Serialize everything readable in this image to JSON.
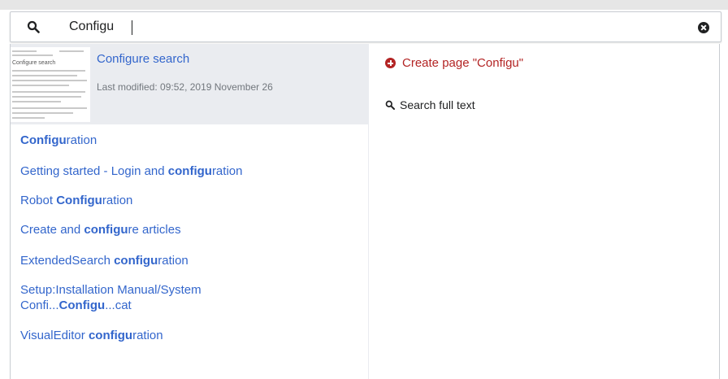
{
  "search": {
    "value": "Configu",
    "placeholder": ""
  },
  "icons": {
    "search": "search-icon",
    "clear": "clear-icon",
    "create": "plus-circle-icon",
    "fulltext": "search-icon"
  },
  "colors": {
    "link": "#3366cc",
    "create": "#b32424",
    "highlight_bg": "#eaecf0"
  },
  "top_result": {
    "title": "Configure search",
    "meta": "Last modified: 09:52, 2019 November 26",
    "thumbnail_text": "Configure search"
  },
  "results": [
    {
      "parts": [
        {
          "text": "Configu",
          "bold": true
        },
        {
          "text": "ration",
          "bold": false
        }
      ]
    },
    {
      "parts": [
        {
          "text": "Getting started - Login and ",
          "bold": false
        },
        {
          "text": "configu",
          "bold": true
        },
        {
          "text": "ration",
          "bold": false
        }
      ]
    },
    {
      "parts": [
        {
          "text": "Robot ",
          "bold": false
        },
        {
          "text": "Configu",
          "bold": true
        },
        {
          "text": "ration",
          "bold": false
        }
      ]
    },
    {
      "parts": [
        {
          "text": "Create and ",
          "bold": false
        },
        {
          "text": "configu",
          "bold": true
        },
        {
          "text": "re articles",
          "bold": false
        }
      ]
    },
    {
      "parts": [
        {
          "text": "ExtendedSearch ",
          "bold": false
        },
        {
          "text": "configu",
          "bold": true
        },
        {
          "text": "ration",
          "bold": false
        }
      ]
    },
    {
      "parts": [
        {
          "text": "Setup:Installation Manual/System\nConfi...",
          "bold": false
        },
        {
          "text": "Configu",
          "bold": true
        },
        {
          "text": "...cat",
          "bold": false
        }
      ]
    },
    {
      "parts": [
        {
          "text": "VisualEditor ",
          "bold": false
        },
        {
          "text": "configu",
          "bold": true
        },
        {
          "text": "ration",
          "bold": false
        }
      ]
    }
  ],
  "actions": {
    "create_label": "Create page \"Configu\"",
    "fulltext_label": "Search full text"
  }
}
